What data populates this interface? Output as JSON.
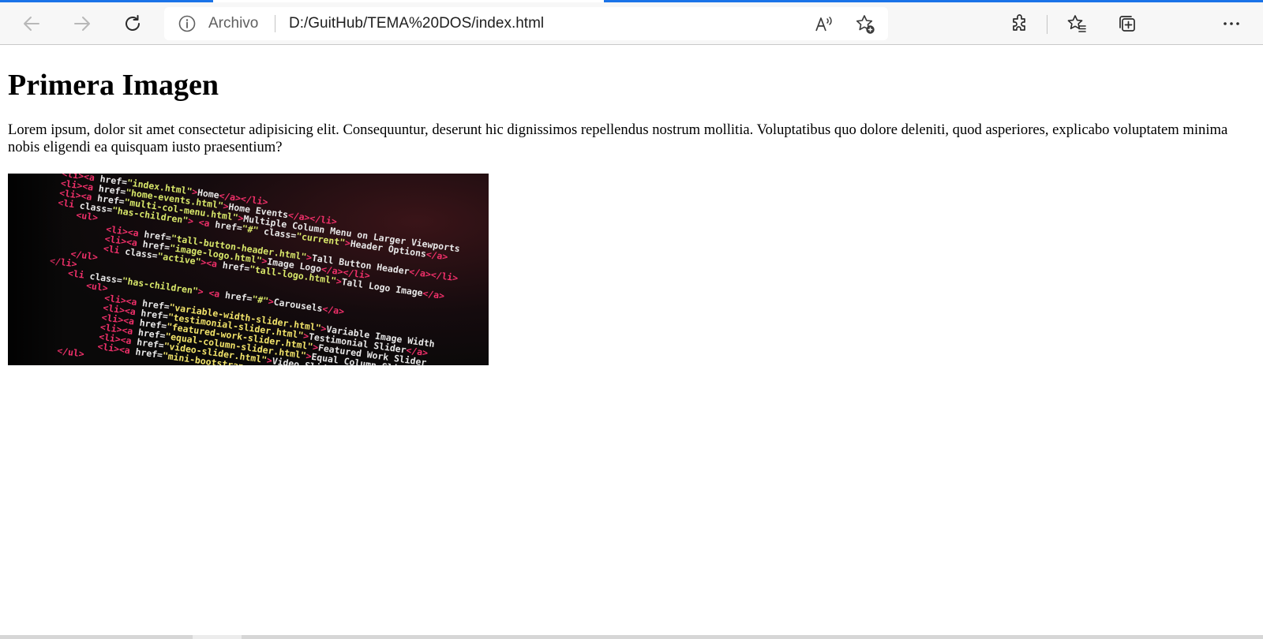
{
  "browser": {
    "site_info_label": "Archivo",
    "url": "D:/GuitHub/TEMA%20DOS/index.html",
    "icons": {
      "back": "arrow-left-icon",
      "forward": "arrow-right-icon",
      "refresh": "refresh-icon",
      "site_info": "info-icon",
      "read_aloud": "read-aloud-icon",
      "add_favorite": "star-add-icon",
      "extensions": "puzzle-icon",
      "favorites": "favorites-icon",
      "collections": "collections-icon",
      "more": "more-icon"
    }
  },
  "page": {
    "title": "Primera Imagen",
    "paragraph": "Lorem ipsum, dolor sit amet consectetur adipisicing elit. Consequuntur, deserunt hic dignissimos repellendus nostrum mollitia. Voluptatibus quo dolore deleniti, quod asperiores, explicabo voluptatem minima nobis eligendi ea quisquam iusto praesentium?",
    "image": {
      "lines": [
        "<li><a href=\"index.html\">Home</a></li>",
        "<li><a href=\"home-events.html\">Home Events</a></li>",
        "<li><a href=\"multi-col-menu.html\">Multiple Column Menu on Larger Viewports",
        "<li class=\"has-children\"> <a href=\"#\" class=\"current\">Header Options</a>",
        "<ul>",
        "<li><a href=\"tall-button-header.html\">Tall Button Header</a></li>",
        "<li><a href=\"image-logo.html\">Image Logo</a></li>",
        "<li class=\"active\"><a href=\"tall-logo.html\">Tall Logo Image</a>",
        "</ul>",
        "</li>",
        "<li class=\"has-children\"> <a href=\"#\">Carousels</a>",
        "<ul>",
        "<li><a href=\"variable-width-slider.html\">Variable Image Width",
        "<li><a href=\"testimonial-slider.html\">Testimonial Slider</a>",
        "<li><a href=\"featured-work-slider.html\">Featured Work Slider",
        "<li><a href=\"equal-column-slider.html\">Equal Column Slider",
        "<li><a href=\"video-slider.html\">Video Slider</a></li>",
        "<li><a href=\"mini-bootstrap-carousel.html\">Mini Slider</a>",
        "</ul>"
      ]
    }
  }
}
